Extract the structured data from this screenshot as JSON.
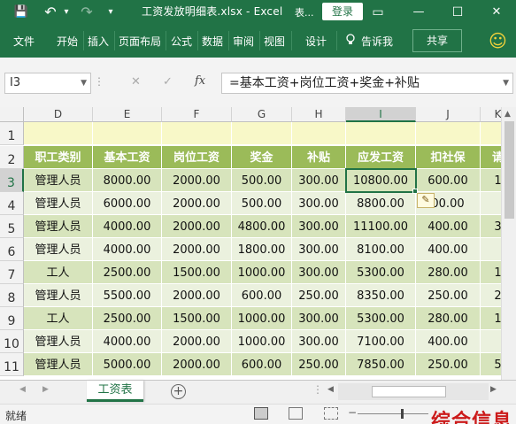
{
  "window": {
    "title": "工资发放明细表.xlsx - Excel",
    "table_tools": "表...",
    "login_label": "登录",
    "restore_label": "▭",
    "minimize_label": "—",
    "maximize_label": "☐",
    "close_label": "✕"
  },
  "quick_access": {
    "save": "💾",
    "undo": "↶",
    "redo": "↷",
    "customize": "▾"
  },
  "ribbon": {
    "tabs": [
      "文件",
      "开始",
      "插入",
      "页面布局",
      "公式",
      "数据",
      "审阅",
      "视图",
      "设计"
    ],
    "tell_me": "告诉我",
    "share": "共享",
    "smiley": "☺"
  },
  "formula_bar": {
    "name_box": "I3",
    "cancel": "✕",
    "enter": "✓",
    "fx": "fx",
    "formula": "=基本工资+岗位工资+奖金+补贴"
  },
  "columns": [
    "D",
    "E",
    "F",
    "G",
    "H",
    "I",
    "J",
    "K"
  ],
  "rows": [
    "1",
    "2",
    "3",
    "4",
    "5",
    "6",
    "7",
    "8",
    "9",
    "10",
    "11"
  ],
  "header_row": [
    "职工类别",
    "基本工资",
    "岗位工资",
    "奖金",
    "补贴",
    "应发工资",
    "扣社保",
    "请"
  ],
  "data_rows": [
    [
      "管理人员",
      "8000.00",
      "2000.00",
      "500.00",
      "300.00",
      "10800.00",
      "600.00",
      "1"
    ],
    [
      "管理人员",
      "6000.00",
      "2000.00",
      "500.00",
      "300.00",
      "8800.00",
      "00.00",
      ""
    ],
    [
      "管理人员",
      "4000.00",
      "2000.00",
      "4800.00",
      "300.00",
      "11100.00",
      "400.00",
      "3"
    ],
    [
      "管理人员",
      "4000.00",
      "2000.00",
      "1800.00",
      "300.00",
      "8100.00",
      "400.00",
      ""
    ],
    [
      "工人",
      "2500.00",
      "1500.00",
      "1000.00",
      "300.00",
      "5300.00",
      "280.00",
      "1"
    ],
    [
      "管理人员",
      "5500.00",
      "2000.00",
      "600.00",
      "250.00",
      "8350.00",
      "250.00",
      "2"
    ],
    [
      "工人",
      "2500.00",
      "1500.00",
      "1000.00",
      "300.00",
      "5300.00",
      "280.00",
      "1"
    ],
    [
      "管理人员",
      "4000.00",
      "2000.00",
      "1000.00",
      "300.00",
      "7100.00",
      "400.00",
      ""
    ],
    [
      "管理人员",
      "5000.00",
      "2000.00",
      "600.00",
      "250.00",
      "7850.00",
      "250.00",
      "5"
    ]
  ],
  "sheet_tabs": {
    "active": "工资表",
    "add": "+"
  },
  "status": {
    "ready": "就绪",
    "watermark": "综合信息"
  },
  "colors": {
    "brand": "#217346",
    "header_fill": "#9bbb59",
    "row_dark": "#d7e4bc",
    "row_light": "#ebf1de",
    "title_row": "#f8f8c8"
  }
}
